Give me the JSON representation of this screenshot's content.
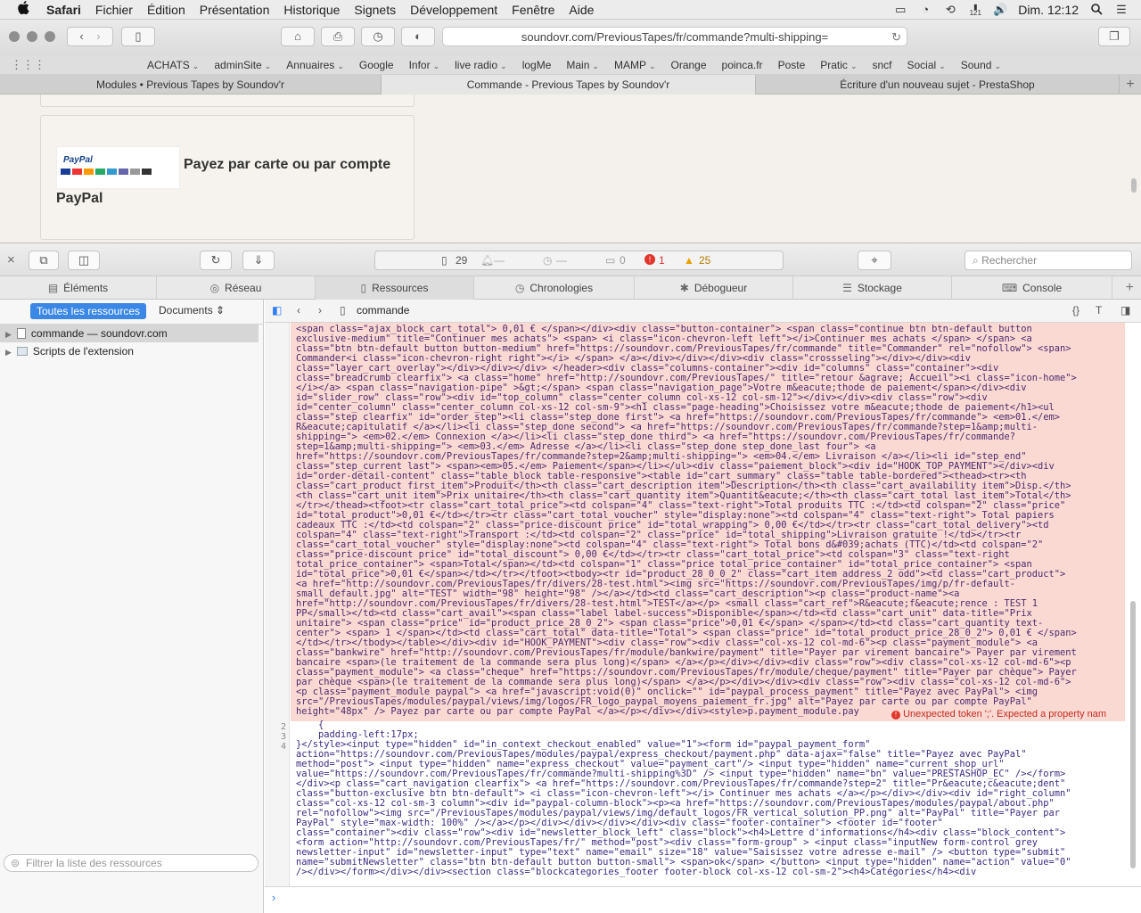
{
  "menubar": {
    "apple": "",
    "app": "Safari",
    "items": [
      "Fichier",
      "Édition",
      "Présentation",
      "Historique",
      "Signets",
      "Développement",
      "Fenêtre",
      "Aide"
    ],
    "clock": "Dim. 12:12",
    "badge": "121"
  },
  "toolbar": {
    "url": "soundovr.com/PreviousTapes/fr/commande?multi-shipping="
  },
  "bookmarks": {
    "items": [
      "ACHATS",
      "adminSite",
      "Annuaires",
      "Google",
      "Infor",
      "live radio",
      "logMe",
      "Main",
      "MAMP",
      "Orange",
      "poinca.fr",
      "Poste",
      "Pratic",
      "sncf",
      "Social",
      "Sound"
    ]
  },
  "tabs": [
    {
      "title": "Modules • Previous Tapes by Soundov'r"
    },
    {
      "title": "Commande - Previous Tapes by Soundov'r"
    },
    {
      "title": "Écriture d'un nouveau sujet - PrestaShop"
    }
  ],
  "page": {
    "paypal_logo": "PayPal",
    "pay_title_1": "Payez par carte ou par compte",
    "pay_title_2": "PayPal"
  },
  "inspector": {
    "resources_count": "29",
    "dash1": "—",
    "dash2": "—",
    "messages": "0",
    "errors": "1",
    "warnings": "25",
    "search_placeholder": "Rechercher",
    "tabs": [
      "Éléments",
      "Réseau",
      "Ressources",
      "Chronologies",
      "Débogueur",
      "Stockage",
      "Console"
    ],
    "all_resources": "Toutes les ressources",
    "documents": "Documents",
    "tree": [
      {
        "label": "commande — soundovr.com"
      },
      {
        "label": "Scripts de l'extension"
      }
    ],
    "filter_placeholder": "Filtrer la liste des ressources",
    "file": "commande",
    "error_message": "Unexpected token ';'. Expected a property nam",
    "line_numbers": [
      "2",
      "3",
      "4"
    ]
  },
  "code_lines": [
    "<span class=\"ajax_block_cart_total\"> 0,01 € </span></div><div class=\"button-container\"> <span class=\"continue btn btn-default button",
    "exclusive-medium\" title=\"Continuer mes achats\"> <span> <i class=\"icon-chevron-left left\"></i>Continuer mes achats </span> </span> <a",
    "class=\"btn btn-default button button-medium\" href=\"https://soundovr.com/PreviousTapes/fr/commande\" title=\"Commander\" rel=\"nofollow\"> <span>",
    "Commander<i class=\"icon-chevron-right right\"></i> </span> </a></div></div></div><div class=\"crossseling\"></div></div><div",
    "class=\"layer_cart_overlay\"></div></div></div> </header><div class=\"columns-container\"><div id=\"columns\" class=\"container\"><div",
    "class=\"breadcrumb clearfix\"> <a class=\"home\" href=\"http://soundovr.com/PreviousTapes/\" title=\"retour &agrave; Accueil\"><i class=\"icon-home\">",
    "</i></a> <span class=\"navigation-pipe\" >&gt;</span> <span class=\"navigation_page\">Votre m&eacute;thode de paiement</span></div><div",
    "id=\"slider_row\" class=\"row\"><div id=\"top_column\" class=\"center_column col-xs-12 col-sm-12\"></div></div><div class=\"row\"><div",
    "id=\"center_column\" class=\"center_column col-xs-12 col-sm-9\"><h1 class=\"page-heading\">Choisissez votre m&eacute;thode de paiement</h1><ul",
    "class=\"step clearfix\" id=\"order_step\"><li class=\"step_done first\"> <a href=\"https://soundovr.com/PreviousTapes/fr/commande\"> <em>01.</em>",
    "R&eacute;capitulatif </a></li><li class=\"step_done second\"> <a href=\"https://soundovr.com/PreviousTapes/fr/commande?step=1&amp;multi-",
    "shipping=\"> <em>02.</em> Connexion </a></li><li class=\"step_done third\"> <a href=\"https://soundovr.com/PreviousTapes/fr/commande?",
    "step=1&amp;multi-shipping=\"> <em>03.</em> Adresse </a></li><li class=\"step_done step_done_last four\"> <a",
    "href=\"https://soundovr.com/PreviousTapes/fr/commande?step=2&amp;multi-shipping=\"> <em>04.</em> Livraison </a></li><li id=\"step_end\"",
    "class=\"step_current last\"> <span><em>05.</em> Paiement</span></li></ul><div class=\"paiement_block\"><div id=\"HOOK_TOP_PAYMENT\"></div><div",
    "id=\"order-detail-content\" class=\"table_block table-responsive\"><table id=\"cart_summary\" class=\"table table-bordered\"><thead><tr><th",
    "class=\"cart_product first_item\">Produit</th><th class=\"cart_description item\">Description</th><th class=\"cart_availability item\">Disp.</th>",
    "<th class=\"cart_unit item\">Prix unitaire</th><th class=\"cart_quantity item\">Quantit&eacute;</th><th class=\"cart_total last_item\">Total</th>",
    "</tr></thead><tfoot><tr class=\"cart_total_price\"><td colspan=\"4\" class=\"text-right\">Total produits TTC :</td><td colspan=\"2\" class=\"price\"",
    "id=\"total_product\">0,01 €</td></tr><tr class=\"cart_total_voucher\" style=\"display:none\"><td colspan=\"4\" class=\"text-right\"> Total papiers",
    "cadeaux TTC :</td><td colspan=\"2\" class=\"price-discount price\" id=\"total_wrapping\"> 0,00 €</td></tr><tr class=\"cart_total_delivery\"><td",
    "colspan=\"4\" class=\"text-right\">Transport :</td><td colspan=\"2\" class=\"price\" id=\"total_shipping\">Livraison gratuite !</td></tr><tr",
    "class=\"cart_total_voucher\" style=\"display:none\"><td colspan=\"4\" class=\"text-right\"> Total bons d&#039;achats (TTC)</td><td colspan=\"2\"",
    "class=\"price-discount price\" id=\"total_discount\"> 0,00 €</td></tr><tr class=\"cart_total_price\"><td colspan=\"3\" class=\"text-right",
    "total_price_container\"> <span>Total</span></td><td colspan=\"1\" class=\"price total_price_container\" id=\"total_price_container\"> <span",
    "id=\"total_price\">0,01 €</span></td></tr></tfoot><tbody><tr id=\"product_28_0_0_2\" class=\"cart_item address_2 odd\"><td class=\"cart_product\">",
    "<a href=\"http://soundovr.com/PreviousTapes/fr/divers/28-test.html\"><img src=\"https://soundovr.com/PreviousTapes/img/p/fr-default-",
    "small_default.jpg\" alt=\"TEST\" width=\"98\" height=\"98\" /></a></td><td class=\"cart_description\"><p class=\"product-name\"><a",
    "href=\"http://soundovr.com/PreviousTapes/fr/divers/28-test.html\">TEST</a></p> <small class=\"cart_ref\">R&eacute;f&eacute;rence : TEST 1",
    "PP</small></td><td class=\"cart_avail\"><span class=\"label label-success\">Disponible</span></td><td class=\"cart_unit\" data-title=\"Prix",
    "unitaire\"> <span class=\"price\" id=\"product_price_28_0_2\"> <span class=\"price\">0,01 €</span> </span></td><td class=\"cart_quantity text-",
    "center\"> <span> 1 </span></td><td class=\"cart_total\" data-title=\"Total\"> <span class=\"price\" id=\"total_product_price_28_0_2\"> 0,01 € </span>",
    "</td></tr></tbody></table></div><div id=\"HOOK_PAYMENT\"><div class=\"row\"><div class=\"col-xs-12 col-md-6\"><p class=\"payment_module\"> <a",
    "class=\"bankwire\" href=\"http://soundovr.com/PreviousTapes/fr/module/bankwire/payment\" title=\"Payer par virement bancaire\"> Payer par virement",
    "bancaire <span>(le traitement de la commande sera plus long)</span> </a></p></div></div><div class=\"row\"><div class=\"col-xs-12 col-md-6\"><p",
    "class=\"payment_module\"> <a class=\"cheque\" href=\"https://soundovr.com/PreviousTapes/fr/module/cheque/payment\" title=\"Payer par chèque\"> Payer",
    "par chèque <span>(le traitement de la commande sera plus long)</span> </a></p></div></div><div class=\"row\"><div class=\"col-xs-12 col-md-6\">",
    "<p class=\"payment_module paypal\"> <a href=\"javascript:void(0)\" onclick=\"\" id=\"paypal_process_payment\" title=\"Payez avec PayPal\"> <img",
    "src=\"/PreviousTapes/modules/paypal/views/img/logos/FR_logo_paypal_moyens_paiement_fr.jpg\" alt=\"Payez par carte ou par compte PayPal\"",
    "height=\"48px\" /> Payez par carte ou par compte PayPal </a></p></div></div><style>p.payment_module.pay",
    "{",
    "    padding-left:17px;",
    "}</style><input type=\"hidden\" id=\"in_context_checkout_enabled\" value=\"1\"><form id=\"paypal_payment_form\"",
    "action=\"https://soundovr.com/PreviousTapes/modules/paypal/express_checkout/payment.php\" data-ajax=\"false\" title=\"Payez avec PayPal\"",
    "method=\"post\"> <input type=\"hidden\" name=\"express_checkout\" value=\"payment_cart\"/> <input type=\"hidden\" name=\"current_shop_url\"",
    "value=\"https://soundovr.com/PreviousTapes/fr/commande?multi-shipping%3D\" /> <input type=\"hidden\" name=\"bn\" value=\"PRESTASHOP_EC\" /></form>",
    "</div><p class=\"cart_navigation clearfix\"> <a href=\"https://soundovr.com/PreviousTapes/fr/commande?step=2\" title=\"Pr&eacute;c&eacute;dent\"",
    "class=\"button-exclusive btn btn-default\"> <i class=\"icon-chevron-left\"></i> Continuer mes achats </a></p></div></div><div id=\"right_column\"",
    "class=\"col-xs-12 col-sm-3 column\"><div id=\"paypal-column-block\"><p><a href=\"https://soundovr.com/PreviousTapes/modules/paypal/about.php\"",
    "rel=\"nofollow\"><img src=\"/PreviousTapes/modules/paypal/views/img/default_logos/FR_vertical_solution_PP.png\" alt=\"PayPal\" title=\"Payer par",
    "PayPal\" style=\"max-width: 100%\" /></a></p></div></div></div></div><div class=\"footer-container\"> <footer id=\"footer\"",
    "class=\"container\"><div class=\"row\"><div id=\"newsletter_block_left\" class=\"block\"><h4>Lettre d'informations</h4><div class=\"block_content\">",
    "<form action=\"http://soundovr.com/PreviousTapes/fr/\" method=\"post\"><div class=\"form-group\" > <input class=\"inputNew form-control grey",
    "newsletter-input\" id=\"newsletter-input\" type=\"text\" name=\"email\" size=\"18\" value=\"Saisissez votre adresse e-mail\" /> <button type=\"submit\"",
    "name=\"submitNewsletter\" class=\"btn btn-default button button-small\"> <span>ok</span> </button> <input type=\"hidden\" name=\"action\" value=\"0\"",
    "/></div></form></div></div><section class=\"blockcategories_footer footer-block col-xs-12 col-sm-2\"><h4>Catégories</h4><div"
  ]
}
